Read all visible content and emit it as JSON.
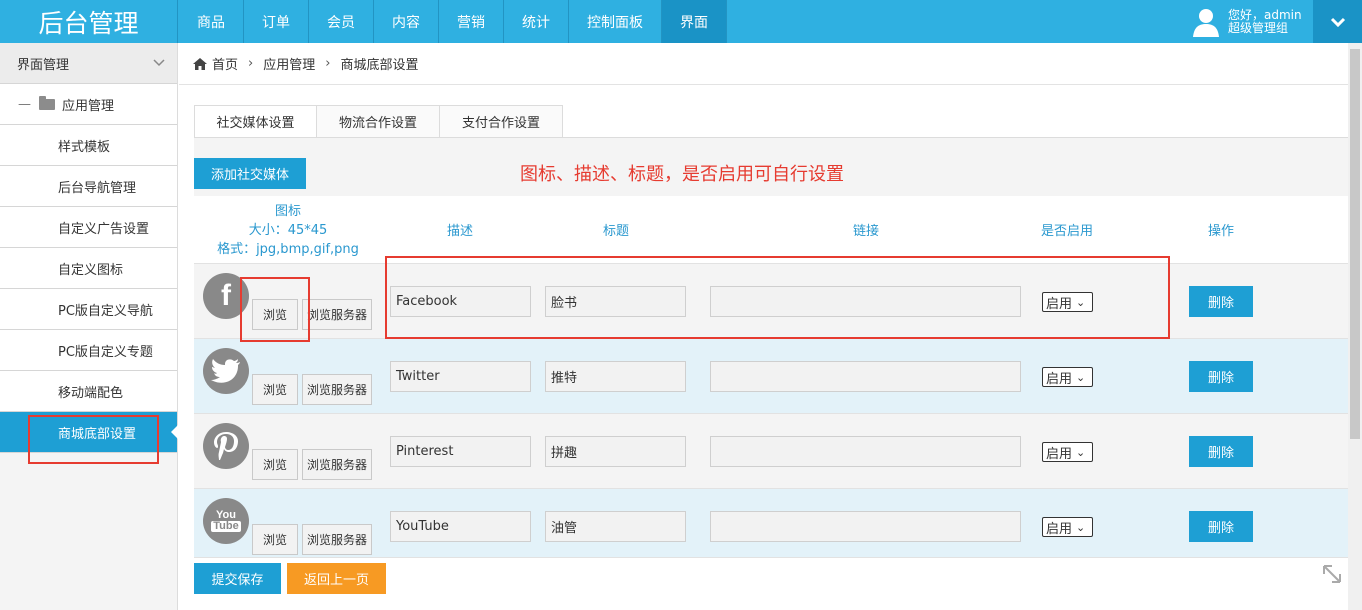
{
  "brand": "后台管理",
  "nav": [
    "商品",
    "订单",
    "会员",
    "内容",
    "营销",
    "统计",
    "控制面板",
    "界面"
  ],
  "nav_active": "界面",
  "user": {
    "line1": "您好，admin",
    "line2": "超级管理组"
  },
  "sidebar": {
    "header": "界面管理",
    "group": "应用管理",
    "items": [
      "样式模板",
      "后台导航管理",
      "自定义广告设置",
      "自定义图标",
      "PC版自定义导航",
      "PC版自定义专题",
      "移动端配色",
      "商城底部设置"
    ],
    "active": "商城底部设置"
  },
  "breadcrumb": [
    "首页",
    "应用管理",
    "商城底部设置"
  ],
  "tabs": [
    "社交媒体设置",
    "物流合作设置",
    "支付合作设置"
  ],
  "add_button": "添加社交媒体",
  "note": "图标、描述、标题，是否启用可自行设置",
  "table_headers": {
    "icon": "图标",
    "size": "大小：45*45",
    "format": "格式：jpg,bmp,gif,png",
    "desc": "描述",
    "title": "标题",
    "link": "链接",
    "enabled": "是否启用",
    "action": "操作"
  },
  "rows": [
    {
      "icon": "facebook-icon",
      "glyph": "f",
      "desc": "Facebook",
      "title": "脸书",
      "link": "",
      "enabled": "启用"
    },
    {
      "icon": "twitter-icon",
      "glyph": "t",
      "desc": "Twitter",
      "title": "推特",
      "link": "",
      "enabled": "启用"
    },
    {
      "icon": "pinterest-icon",
      "glyph": "p",
      "desc": "Pinterest",
      "title": "拼趣",
      "link": "",
      "enabled": "启用"
    },
    {
      "icon": "youtube-icon",
      "glyph": "You\nTube",
      "desc": "YouTube",
      "title": "油管",
      "link": "",
      "enabled": "启用"
    }
  ],
  "row_buttons": {
    "browse": "浏览",
    "browse_server": "浏览服务器",
    "delete": "删除"
  },
  "footer": {
    "submit": "提交保存",
    "back": "返回上一页"
  },
  "colors": {
    "primary": "#2fb0e1",
    "accent_orange": "#f79a23",
    "annotation_red": "#e63b30"
  }
}
